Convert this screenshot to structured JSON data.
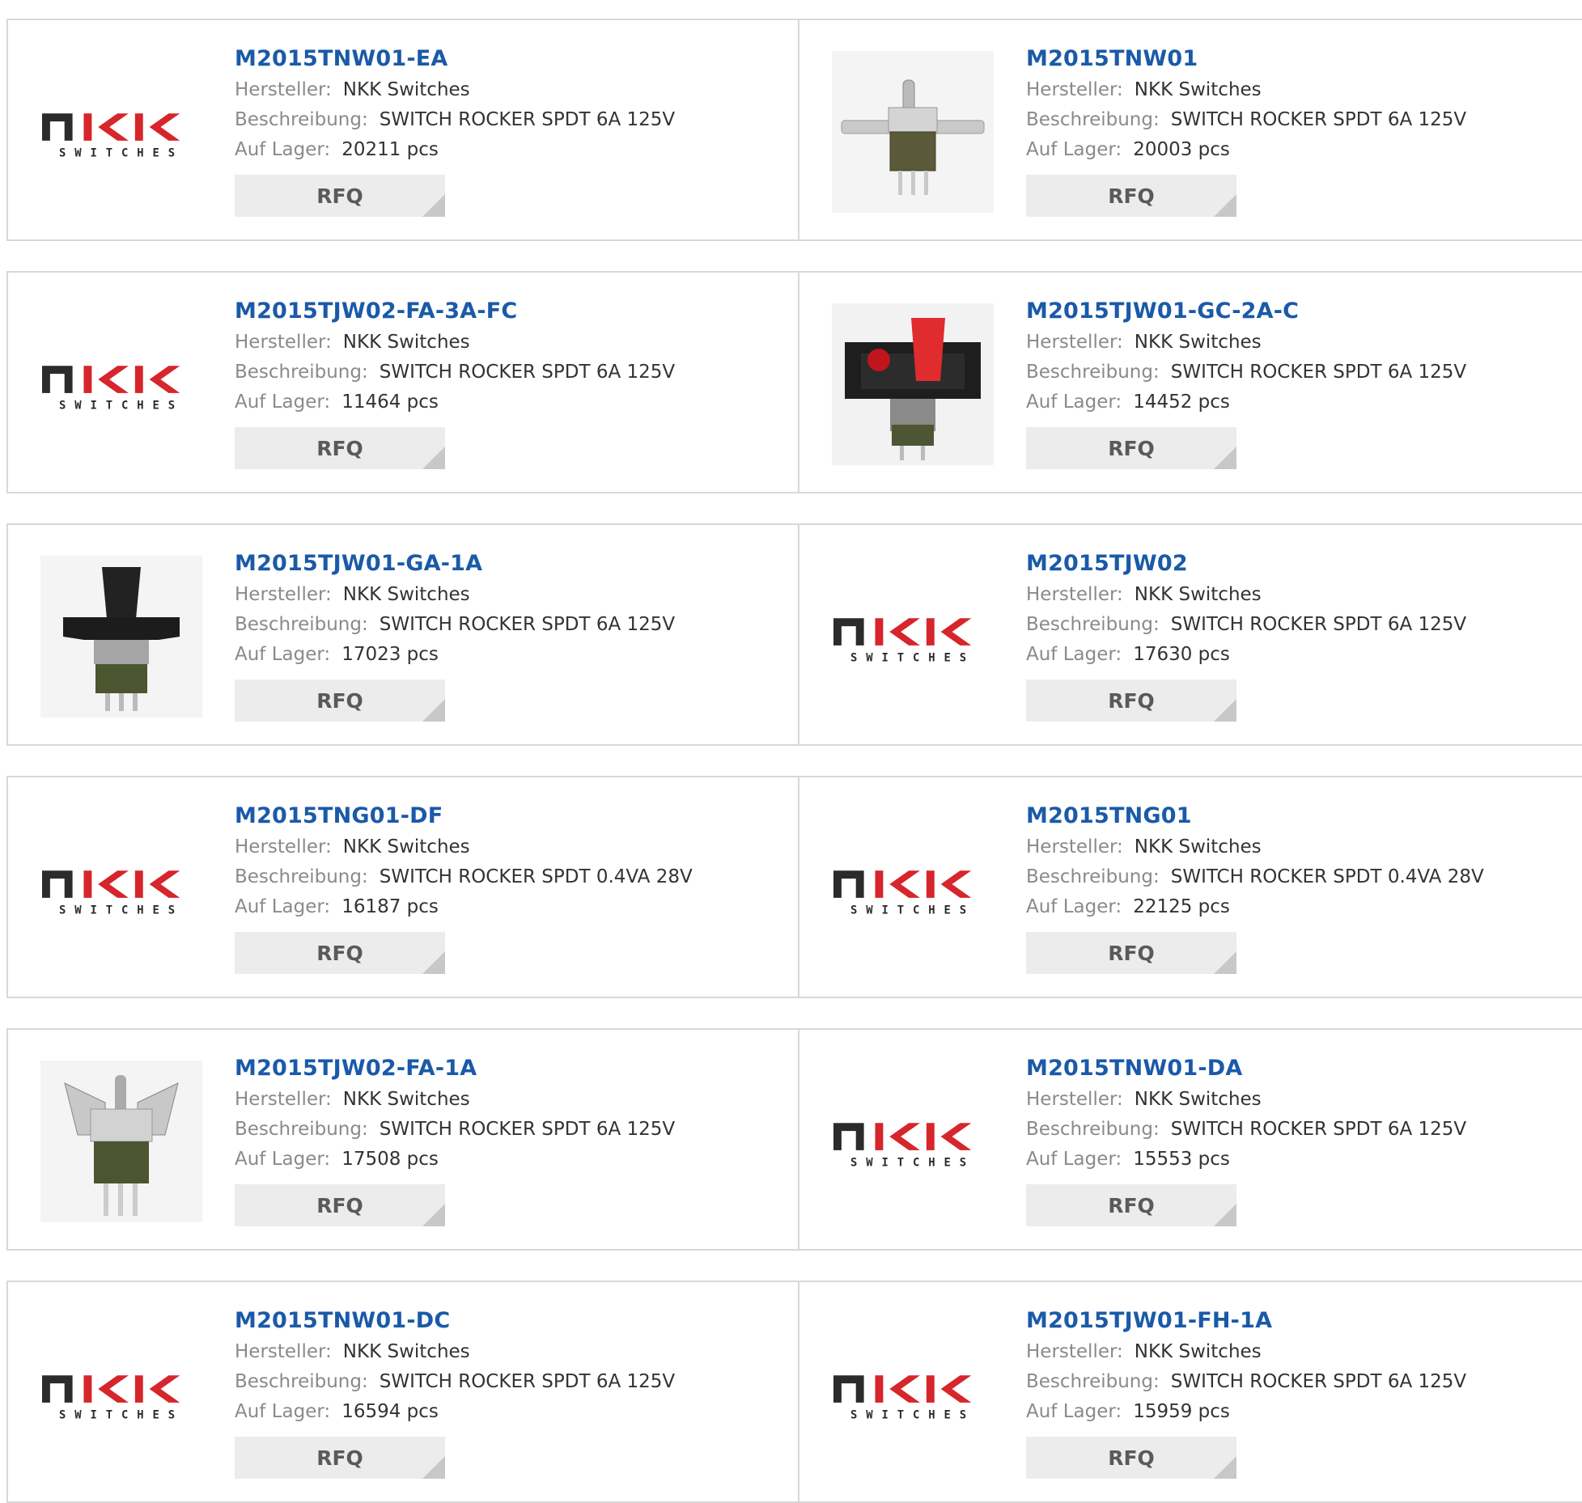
{
  "labels": {
    "manufacturer": "Hersteller:",
    "description": "Beschreibung:",
    "stock": "Auf Lager:",
    "rfq": "RFQ"
  },
  "logo_text": "SWITCHES",
  "colors": {
    "link": "#1a5aa8",
    "label": "#8a8a8a",
    "value": "#333333",
    "button_bg": "#ececec",
    "border": "#d8d8d8",
    "logo_red": "#d6252b",
    "logo_dark": "#2b2b2b"
  },
  "products": [
    {
      "part": "M2015TNW01-EA",
      "manufacturer": "NKK Switches",
      "description": "SWITCH ROCKER SPDT 6A 125V",
      "stock": "20211 pcs",
      "image": "nkk-logo"
    },
    {
      "part": "M2015TNW01",
      "manufacturer": "NKK Switches",
      "description": "SWITCH ROCKER SPDT 6A 125V",
      "stock": "20003 pcs",
      "image": "toggle-switch-photo"
    },
    {
      "part": "M2015TJW02-FA-3A-FC",
      "manufacturer": "NKK Switches",
      "description": "SWITCH ROCKER SPDT 6A 125V",
      "stock": "11464 pcs",
      "image": "nkk-logo"
    },
    {
      "part": "M2015TJW01-GC-2A-C",
      "manufacturer": "NKK Switches",
      "description": "SWITCH ROCKER SPDT 6A 125V",
      "stock": "14452 pcs",
      "image": "red-paddle-switch-photo"
    },
    {
      "part": "M2015TJW01-GA-1A",
      "manufacturer": "NKK Switches",
      "description": "SWITCH ROCKER SPDT 6A 125V",
      "stock": "17023 pcs",
      "image": "black-paddle-switch-photo"
    },
    {
      "part": "M2015TJW02",
      "manufacturer": "NKK Switches",
      "description": "SWITCH ROCKER SPDT 6A 125V",
      "stock": "17630 pcs",
      "image": "nkk-logo"
    },
    {
      "part": "M2015TNG01-DF",
      "manufacturer": "NKK Switches",
      "description": "SWITCH ROCKER SPDT 0.4VA 28V",
      "stock": "16187 pcs",
      "image": "nkk-logo"
    },
    {
      "part": "M2015TNG01",
      "manufacturer": "NKK Switches",
      "description": "SWITCH ROCKER SPDT 0.4VA 28V",
      "stock": "22125 pcs",
      "image": "nkk-logo"
    },
    {
      "part": "M2015TJW02-FA-1A",
      "manufacturer": "NKK Switches",
      "description": "SWITCH ROCKER SPDT 6A 125V",
      "stock": "17508 pcs",
      "image": "guarded-toggle-switch-photo"
    },
    {
      "part": "M2015TNW01-DA",
      "manufacturer": "NKK Switches",
      "description": "SWITCH ROCKER SPDT 6A 125V",
      "stock": "15553 pcs",
      "image": "nkk-logo"
    },
    {
      "part": "M2015TNW01-DC",
      "manufacturer": "NKK Switches",
      "description": "SWITCH ROCKER SPDT 6A 125V",
      "stock": "16594 pcs",
      "image": "nkk-logo"
    },
    {
      "part": "M2015TJW01-FH-1A",
      "manufacturer": "NKK Switches",
      "description": "SWITCH ROCKER SPDT 6A 125V",
      "stock": "15959 pcs",
      "image": "nkk-logo"
    }
  ]
}
